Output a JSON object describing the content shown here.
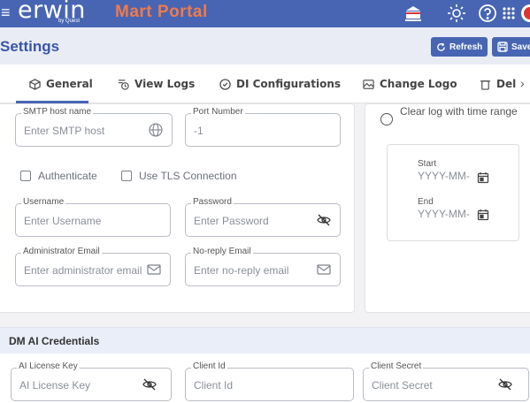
{
  "topbar": {
    "logo": "erwin",
    "logo_sub": "by Quest",
    "app_title": "Mart Portal",
    "icons": [
      "menu-icon",
      "bank-icon",
      "theme-icon",
      "help-icon",
      "apps-grid-icon",
      "user-avatar-icon"
    ]
  },
  "header": {
    "title": "Settings",
    "refresh_label": "Refresh",
    "save_label": "Save"
  },
  "tabs": [
    {
      "label": "General",
      "icon": "cube-icon",
      "active": true
    },
    {
      "label": "View Logs",
      "icon": "logs-icon"
    },
    {
      "label": "DI Configurations",
      "icon": "check-circle-icon"
    },
    {
      "label": "Change Logo",
      "icon": "image-icon"
    },
    {
      "label": "Del",
      "icon": "trash-icon"
    }
  ],
  "general": {
    "smtp_host": {
      "label": "SMTP host name",
      "placeholder": "Enter SMTP host"
    },
    "port": {
      "label": "Port Number",
      "value": "-1"
    },
    "authenticate_label": "Authenticate",
    "tls_label": "Use TLS Connection",
    "username": {
      "label": "Username",
      "placeholder": "Enter Username"
    },
    "password": {
      "label": "Password",
      "placeholder": "Enter Password"
    },
    "admin_email": {
      "label": "Administrator Email",
      "placeholder": "Enter administrator email"
    },
    "noreply_email": {
      "label": "No-reply Email",
      "placeholder": "Enter no-reply email"
    }
  },
  "logs": {
    "clear_option": "Clear log with time range",
    "start_label": "Start",
    "start_value": "YYYY-MM-",
    "end_label": "End",
    "end_value": "YYYY-MM-"
  },
  "dm_ai": {
    "section_title": "DM AI Credentials",
    "license_key": {
      "label": "AI License Key",
      "placeholder": "AI License Key"
    },
    "client_id": {
      "label": "Client Id",
      "placeholder": "Client Id"
    },
    "client_secret": {
      "label": "Client Secret",
      "placeholder": "Client Secret"
    }
  },
  "colors": {
    "primary": "#4765b3",
    "accent": "#f07a4a"
  }
}
